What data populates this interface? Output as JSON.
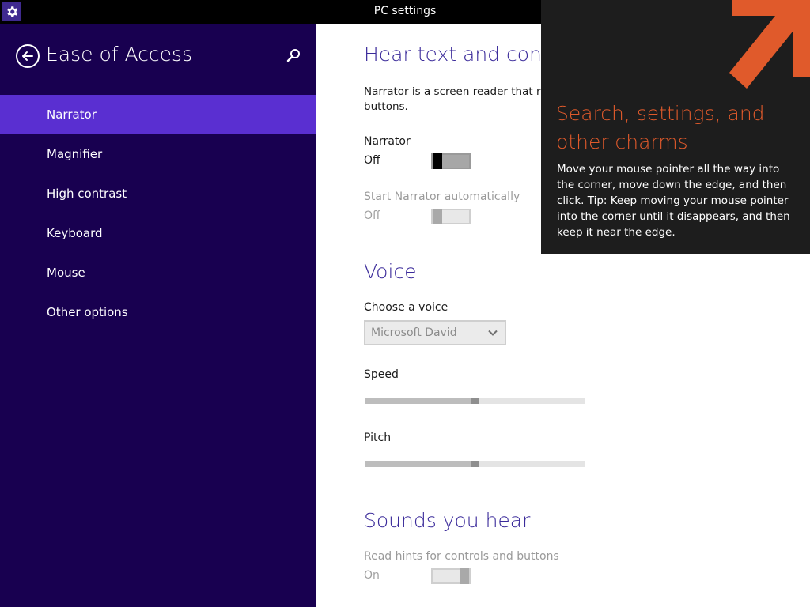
{
  "window": {
    "title": "PC settings",
    "app_icon": "gear-icon"
  },
  "sidebar": {
    "heading": "Ease of Access",
    "back_icon": "back-arrow-icon",
    "search_icon": "search-icon",
    "items": [
      {
        "label": "Narrator",
        "active": true
      },
      {
        "label": "Magnifier",
        "active": false
      },
      {
        "label": "High contrast",
        "active": false
      },
      {
        "label": "Keyboard",
        "active": false
      },
      {
        "label": "Mouse",
        "active": false
      },
      {
        "label": "Other options",
        "active": false
      }
    ]
  },
  "content": {
    "hear_text": {
      "title": "Hear text and contro",
      "description_line1": "Narrator is a screen reader that reac",
      "description_line2": "buttons.",
      "narrator": {
        "label": "Narrator",
        "state": "Off"
      },
      "start_auto": {
        "label": "Start Narrator automatically",
        "state": "Off"
      }
    },
    "voice": {
      "title": "Voice",
      "choose_label": "Choose a voice",
      "selected_voice": "Microsoft David",
      "speed_label": "Speed",
      "speed_level": 0.5,
      "pitch_label": "Pitch",
      "pitch_level": 0.5
    },
    "sounds": {
      "title": "Sounds you hear",
      "hints_label": "Read hints for controls and buttons",
      "hints_state": "On"
    }
  },
  "tooltip": {
    "title": "Search, settings, and other charms",
    "body": "Move your mouse pointer all the way into the corner, move down the edge, and then click. Tip: Keep moving your mouse pointer into the corner until it disappears, and then keep it near the edge."
  },
  "colors": {
    "sidebar_bg": "#180050",
    "sidebar_active": "#5a2fd1",
    "section_title": "#3a2a9a",
    "tooltip_accent": "#e05a2b"
  }
}
